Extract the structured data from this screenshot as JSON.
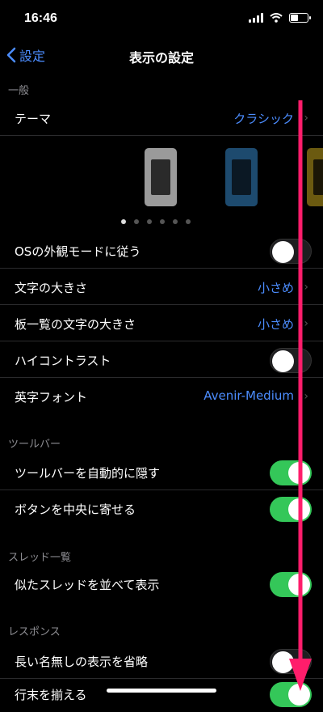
{
  "status": {
    "time": "16:46"
  },
  "nav": {
    "back_label": "設定",
    "title": "表示の設定"
  },
  "sections": {
    "general": "一般",
    "toolbar": "ツールバー",
    "thread_list": "スレッド一覧",
    "response": "レスポンス"
  },
  "rows": {
    "theme": {
      "label": "テーマ",
      "value": "クラシック"
    },
    "os_appearance": {
      "label": "OSの外観モードに従う",
      "on": false
    },
    "text_size": {
      "label": "文字の大きさ",
      "value": "小さめ"
    },
    "board_text_size": {
      "label": "板一覧の文字の大きさ",
      "value": "小さめ"
    },
    "high_contrast": {
      "label": "ハイコントラスト",
      "on": false
    },
    "english_font": {
      "label": "英字フォント",
      "value": "Avenir-Medium"
    },
    "auto_hide_toolbar": {
      "label": "ツールバーを自動的に隠す",
      "on": true
    },
    "center_buttons": {
      "label": "ボタンを中央に寄せる",
      "on": true
    },
    "similar_threads": {
      "label": "似たスレッドを並べて表示",
      "on": true
    },
    "omit_long_anon": {
      "label": "長い名無しの表示を省略",
      "on": false
    },
    "align_line_end": {
      "label": "行末を揃える",
      "on": true
    }
  },
  "theme_previews": [
    {
      "name": "classic",
      "frame": "#9a9a9a",
      "screen": "#2a2a2a"
    },
    {
      "name": "blue",
      "frame": "#1d4a6e",
      "screen": "#0b1824"
    },
    {
      "name": "yellow",
      "frame": "#6b5a10",
      "screen": "#1a1606"
    }
  ],
  "theme_page_count": 6,
  "theme_page_active": 0,
  "colors": {
    "accent": "#4c8dff",
    "toggle_on": "#34c759",
    "annotation_arrow": "#ff1d6b"
  }
}
